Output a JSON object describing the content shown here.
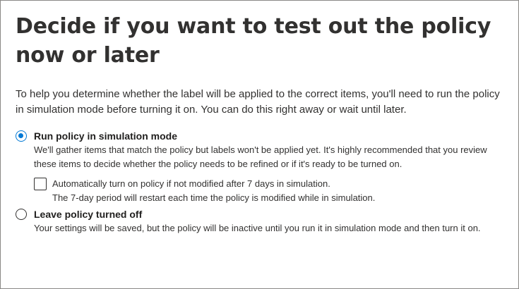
{
  "title": "Decide if you want to test out the policy now or later",
  "intro": "To help you determine whether the label will be applied to the correct items, you'll need to run the policy in simulation mode before turning it on. You can do this right away or wait until later.",
  "options": [
    {
      "label": "Run policy in simulation mode",
      "description": "We'll gather items that match the policy but labels won't be applied yet. It's highly recommended that you review these items to decide whether the policy needs to be refined or if it's ready to be turned on.",
      "selected": true
    },
    {
      "label": "Leave policy turned off",
      "description": "Your settings will be saved, but the policy will be inactive until you run it in simulation mode and then turn it on.",
      "selected": false
    }
  ],
  "auto_turn_on": {
    "label": "Automatically turn on policy if not modified after 7 days in simulation.",
    "description": "The 7-day period will restart each time the policy is modified while in simulation.",
    "checked": false
  },
  "colors": {
    "accent": "#0078d4",
    "text": "#323130",
    "border": "#8a8886"
  }
}
